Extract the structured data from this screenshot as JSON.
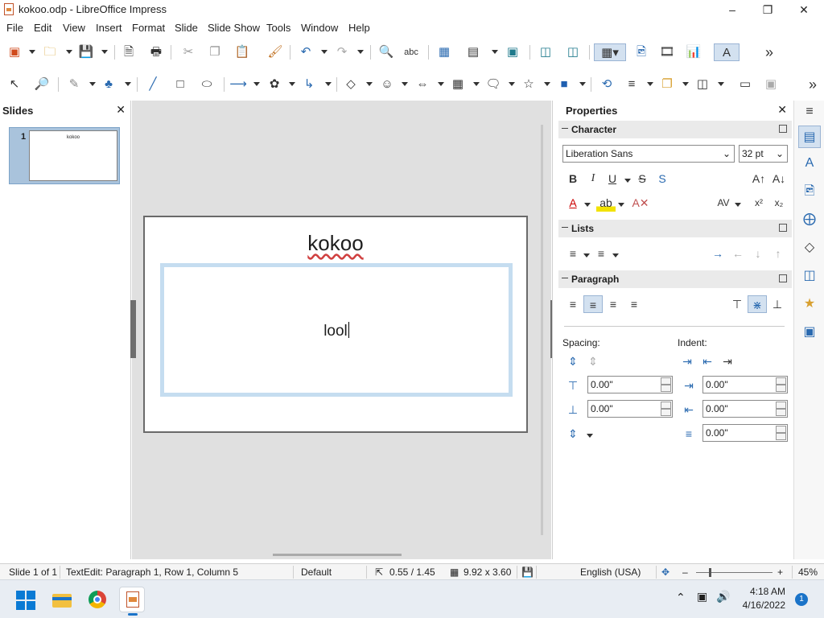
{
  "window": {
    "title": "kokoo.odp - LibreOffice Impress"
  },
  "menu": [
    "File",
    "Edit",
    "View",
    "Insert",
    "Format",
    "Slide",
    "Slide Show",
    "Tools",
    "Window",
    "Help"
  ],
  "slides_pane": {
    "title": "Slides",
    "thumb_number": "1",
    "thumb_title": "kokoo"
  },
  "slide": {
    "title": "kokoo",
    "body": "lool"
  },
  "properties": {
    "title": "Properties",
    "character": {
      "label": "Character",
      "font_name": "Liberation Sans",
      "font_size": "32 pt"
    },
    "lists": {
      "label": "Lists"
    },
    "paragraph": {
      "label": "Paragraph",
      "spacing_label": "Spacing:",
      "indent_label": "Indent:",
      "spacing_above": "0.00\"",
      "spacing_below": "0.00\"",
      "indent_before": "0.00\"",
      "indent_after": "0.00\"",
      "indent_first": "0.00\""
    }
  },
  "statusbar": {
    "slide": "Slide 1 of 1",
    "edit": "TextEdit: Paragraph 1, Row 1, Column 5",
    "layout": "Default",
    "position": "0.55 / 1.45",
    "size": "9.92 x 3.60",
    "language": "English (USA)",
    "zoom": "45%"
  },
  "taskbar": {
    "time": "4:18 AM",
    "date": "4/16/2022",
    "notifications": "1"
  },
  "colors": {
    "accent": "#2a6ab0",
    "selection": "#c5ddf0",
    "canvas": "#e0e0e0"
  }
}
